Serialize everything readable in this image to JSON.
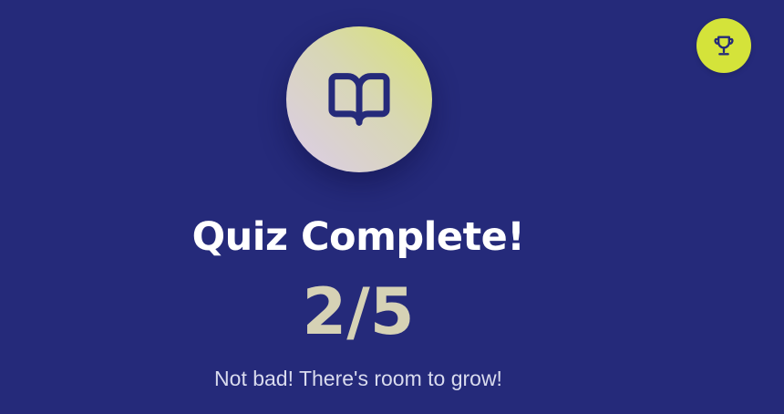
{
  "header": {
    "trophy_icon": "trophy-icon",
    "accent_color": "#d4e33a"
  },
  "hero": {
    "icon": "book-open-icon"
  },
  "result": {
    "title": "Quiz Complete!",
    "score": "2/5",
    "message": "Not bad! There's room to grow!"
  },
  "colors": {
    "background": "#252a7a",
    "score_text": "#d6d2b5"
  }
}
